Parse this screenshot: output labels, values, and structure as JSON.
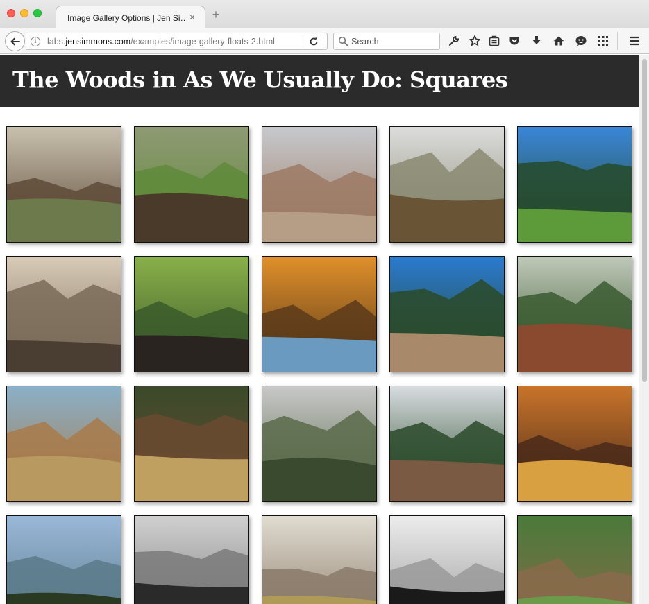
{
  "browser": {
    "tab_title": "Image Gallery Options | Jen Si…",
    "tab_close": "×",
    "new_tab": "+",
    "url_prefix": "labs.",
    "url_domain": "jensimmons.com",
    "url_path": "/examples/image-gallery-floats-2.html",
    "search_placeholder": "Search",
    "toolbar_icons": [
      "wrench-icon",
      "bookmark-star-icon",
      "reading-list-icon",
      "pocket-icon",
      "download-icon",
      "home-icon",
      "chat-icon",
      "grid-icon",
      "menu-icon"
    ]
  },
  "page": {
    "title": "The Woods in As We Usually Do: Squares"
  },
  "gallery": {
    "images": [
      {
        "name": "weathered-wooden-cabin",
        "palette": [
          "#c8c0ae",
          "#5e4b38",
          "#6c7a4c"
        ]
      },
      {
        "name": "trail-signpost-meadow",
        "palette": [
          "#8f9a74",
          "#5f8a3a",
          "#4a3a2a"
        ]
      },
      {
        "name": "rocky-desert-mountains",
        "palette": [
          "#c7c9cd",
          "#9c7a64",
          "#b59d86"
        ]
      },
      {
        "name": "hiker-on-hillside-trail",
        "palette": [
          "#dcdcdc",
          "#8a8a72",
          "#6a5436"
        ]
      },
      {
        "name": "forest-meadow-blue-sky",
        "palette": [
          "#3a86d8",
          "#264a2a",
          "#5d9a3a"
        ]
      },
      {
        "name": "vintage-cabin-horse-cart",
        "palette": [
          "#d8cbb8",
          "#7a6a58",
          "#4a3e32"
        ]
      },
      {
        "name": "tree-trunk-mushrooms",
        "palette": [
          "#8ab04a",
          "#3a5a2a",
          "#2a2420"
        ]
      },
      {
        "name": "autumn-forest-lake",
        "palette": [
          "#e0902a",
          "#5a3a1a",
          "#6a9ac0"
        ]
      },
      {
        "name": "forested-mountain-valley",
        "palette": [
          "#2a7ad0",
          "#2a4a28",
          "#a88a6a"
        ]
      },
      {
        "name": "aspen-forest-path",
        "palette": [
          "#bfc8b8",
          "#3a5a30",
          "#8a4a30"
        ]
      },
      {
        "name": "old-farmhouse-rusty-roof",
        "palette": [
          "#8ab0c8",
          "#a87a4a",
          "#b89a60"
        ]
      },
      {
        "name": "log-cabin-in-pines",
        "palette": [
          "#3a4a2a",
          "#6a4a30",
          "#c0a060"
        ]
      },
      {
        "name": "foggy-mountain-slope",
        "palette": [
          "#c8c8c8",
          "#5a6a4a",
          "#3a4a2e"
        ]
      },
      {
        "name": "lake-stone-ruins",
        "palette": [
          "#d8dce0",
          "#2a4a2a",
          "#7a5a42"
        ]
      },
      {
        "name": "autumn-woods-orange",
        "palette": [
          "#c8742a",
          "#4a2a1a",
          "#d8a040"
        ]
      },
      {
        "name": "mountain-vista-pines",
        "palette": [
          "#9ab8d8",
          "#5a7a8a",
          "#2a3a22"
        ]
      },
      {
        "name": "bw-hiker-lake-view",
        "palette": [
          "#d0d0d0",
          "#7a7a7a",
          "#2a2a2a"
        ]
      },
      {
        "name": "hiker-golden-grass-peaks",
        "palette": [
          "#e0dcd0",
          "#8a7a6a",
          "#b09a58"
        ]
      },
      {
        "name": "bw-vintage-group-photo",
        "palette": [
          "#ececec",
          "#9a9a9a",
          "#1a1a1a"
        ]
      },
      {
        "name": "wooden-trough-meadow",
        "palette": [
          "#4a7a3a",
          "#8a6a4a",
          "#6a9a4a"
        ]
      }
    ]
  }
}
